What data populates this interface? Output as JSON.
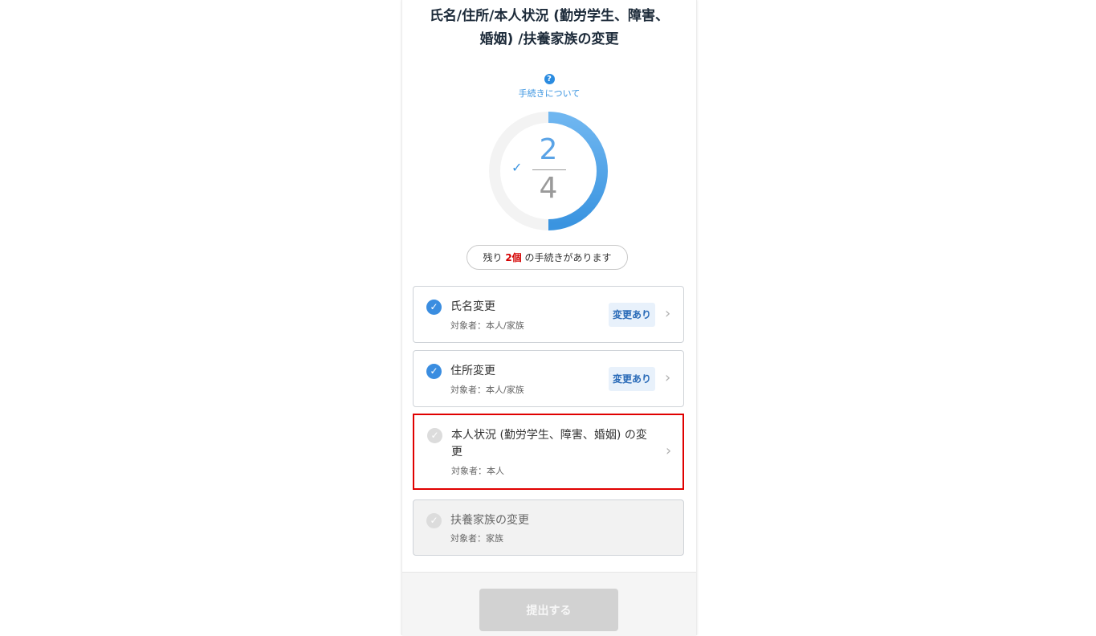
{
  "header": {
    "title_line1": "氏名/住所/本人状況 (勤労学生、障害、",
    "title_line2": "婚姻) /扶養家族の変更"
  },
  "help": {
    "icon": "question-icon",
    "icon_glyph": "?",
    "label": "手続きについて"
  },
  "progress": {
    "completed": "2",
    "total": "4",
    "fraction": 0.5,
    "check_glyph": "✓",
    "ring_color": "#3a94e0"
  },
  "remaining": {
    "prefix": "残り",
    "count": "2個",
    "suffix": "の手続きがあります"
  },
  "procedures": [
    {
      "title": "氏名変更",
      "target": "対象者：本人/家族",
      "badge": "変更あり",
      "done": true
    },
    {
      "title": "住所変更",
      "target": "対象者：本人/家族",
      "badge": "変更あり",
      "done": true
    },
    {
      "title_line1": "本人状況 (勤労学生、障害、婚姻) の変",
      "title_line2": "更",
      "target": "対象者：本人",
      "done": false,
      "highlighted": true
    },
    {
      "title": "扶養家族の変更",
      "target": "対象者：家族",
      "done": false,
      "disabled": true
    }
  ],
  "glyphs": {
    "check": "✓",
    "chevron": "›"
  },
  "footer": {
    "submit_label": "提出する"
  },
  "colors": {
    "accent": "#3a8de0",
    "highlight_border": "#e00000",
    "remaining_count": "#d40000",
    "submit_disabled": "#d2d2d2"
  }
}
